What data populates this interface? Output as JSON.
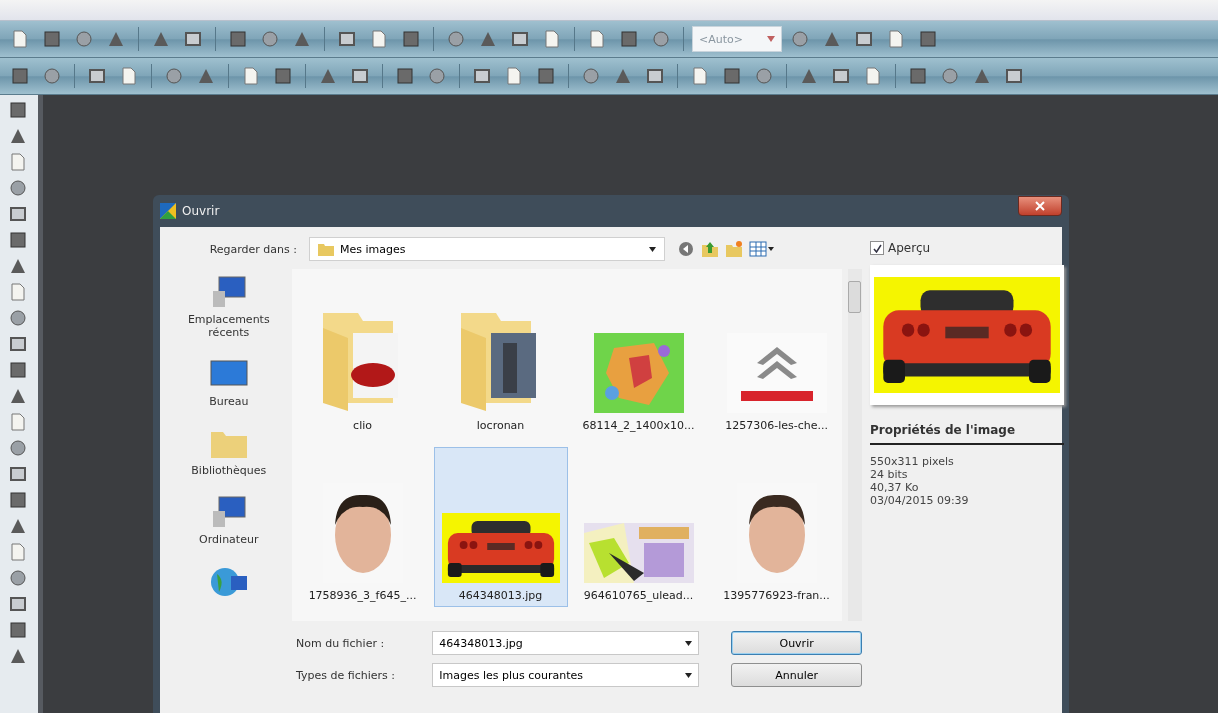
{
  "toolbar": {
    "zoom_combo": "<Auto>"
  },
  "dialog": {
    "title": "Ouvrir",
    "look_in": {
      "label": "Regarder dans :",
      "value": "Mes images"
    },
    "places": [
      {
        "label": "Emplacements récents"
      },
      {
        "label": "Bureau"
      },
      {
        "label": "Bibliothèques"
      },
      {
        "label": "Ordinateur"
      }
    ],
    "files": [
      {
        "name": "clio",
        "kind": "folder",
        "selected": false
      },
      {
        "name": "locronan",
        "kind": "folder",
        "selected": false
      },
      {
        "name": "68114_2_1400x10...",
        "kind": "picture",
        "selected": false
      },
      {
        "name": "1257306-les-che...",
        "kind": "picture",
        "selected": false
      },
      {
        "name": "1758936_3_f645_...",
        "kind": "picture",
        "selected": false
      },
      {
        "name": "464348013.jpg",
        "kind": "picture",
        "selected": true
      },
      {
        "name": "964610765_ulead...",
        "kind": "picture",
        "selected": false
      },
      {
        "name": "1395776923-fran...",
        "kind": "picture",
        "selected": false
      }
    ],
    "filename": {
      "label": "Nom du fichier :",
      "value": "464348013.jpg"
    },
    "filetype": {
      "label": "Types de fichiers :",
      "value": "Images les plus courantes"
    },
    "buttons": [
      {
        "label": "Ouvrir",
        "default": true
      },
      {
        "label": "Annuler",
        "default": false
      }
    ],
    "preview": {
      "label": "Aperçu",
      "checked": true
    },
    "properties": {
      "title": "Propriétés de l'image",
      "lines": [
        "550x311 pixels",
        "24 bits",
        "40,37 Ko",
        "03/04/2015 09:39"
      ]
    }
  }
}
